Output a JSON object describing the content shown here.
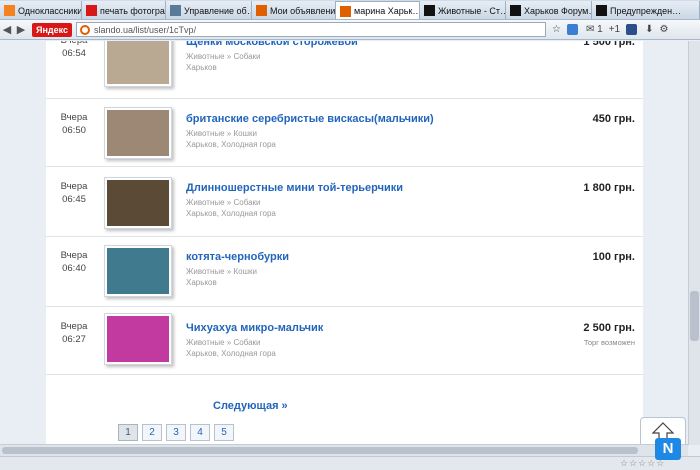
{
  "browser": {
    "tabs": [
      {
        "label": "Одноклассники",
        "icon": "odnoklassniki-icon",
        "color": "#f58220"
      },
      {
        "label": "печать фотогра…",
        "icon": "yandex-icon",
        "color": "#d81818"
      },
      {
        "label": "Управление об…",
        "icon": "page-icon",
        "color": "#5a7a9a"
      },
      {
        "label": "Мои объявлени…",
        "icon": "slando-icon",
        "color": "#e06000"
      },
      {
        "label": "марина Харьк…",
        "icon": "slando-icon",
        "color": "#e06000",
        "active": true
      },
      {
        "label": "Животные - Ст…",
        "icon": "forum-icon",
        "color": "#111"
      },
      {
        "label": "Харьков Форум…",
        "icon": "forum-icon",
        "color": "#111"
      },
      {
        "label": "Предупрежден…",
        "icon": "forum-icon",
        "color": "#111"
      }
    ],
    "yandex_label": "Яндекс",
    "url": "slando.ua/list/user/1cTvp/",
    "mail_count": "1",
    "plus_count": "+1"
  },
  "listings": [
    {
      "date": "Вчера",
      "time": "06:54",
      "title": "Щенки московской сторожевой",
      "category": "Животные » Собаки",
      "location": "Харьков",
      "price": "1 500 грн.",
      "note": "",
      "photo": "puppies-photo",
      "photo_color": "#b9a892"
    },
    {
      "date": "Вчера",
      "time": "06:50",
      "title": "британские серебристые вискасы(мальчики)",
      "category": "Животные » Кошки",
      "location": "Харьков, Холодная гора",
      "price": "450 грн.",
      "note": "",
      "photo": "kittens-photo",
      "photo_color": "#9c8874"
    },
    {
      "date": "Вчера",
      "time": "06:45",
      "title": "Длинношерстные мини той-терьерчики",
      "category": "Животные » Собаки",
      "location": "Харьков, Холодная гора",
      "price": "1 800 грн.",
      "note": "",
      "photo": "toy-terrier-photo",
      "photo_color": "#5a4a36"
    },
    {
      "date": "Вчера",
      "time": "06:40",
      "title": "котята-чернобурки",
      "category": "Животные » Кошки",
      "location": "Харьков",
      "price": "100 грн.",
      "note": "",
      "photo": "kitten-photo",
      "photo_color": "#3f7a8e"
    },
    {
      "date": "Вчера",
      "time": "06:27",
      "title": "Чихуахуа микро-мальчик",
      "category": "Животные » Собаки",
      "location": "Харьков, Холодная гора",
      "price": "2 500 грн.",
      "note": "Торг возможен",
      "photo": "chihuahua-photo",
      "photo_color": "#c23aa0"
    }
  ],
  "pagination": {
    "next_label": "Следующая »",
    "pages": [
      "1",
      "2",
      "3",
      "4",
      "5"
    ],
    "current": "1"
  },
  "widgets": {
    "n_badge": "N",
    "rating_stars": "☆☆☆☆☆"
  }
}
